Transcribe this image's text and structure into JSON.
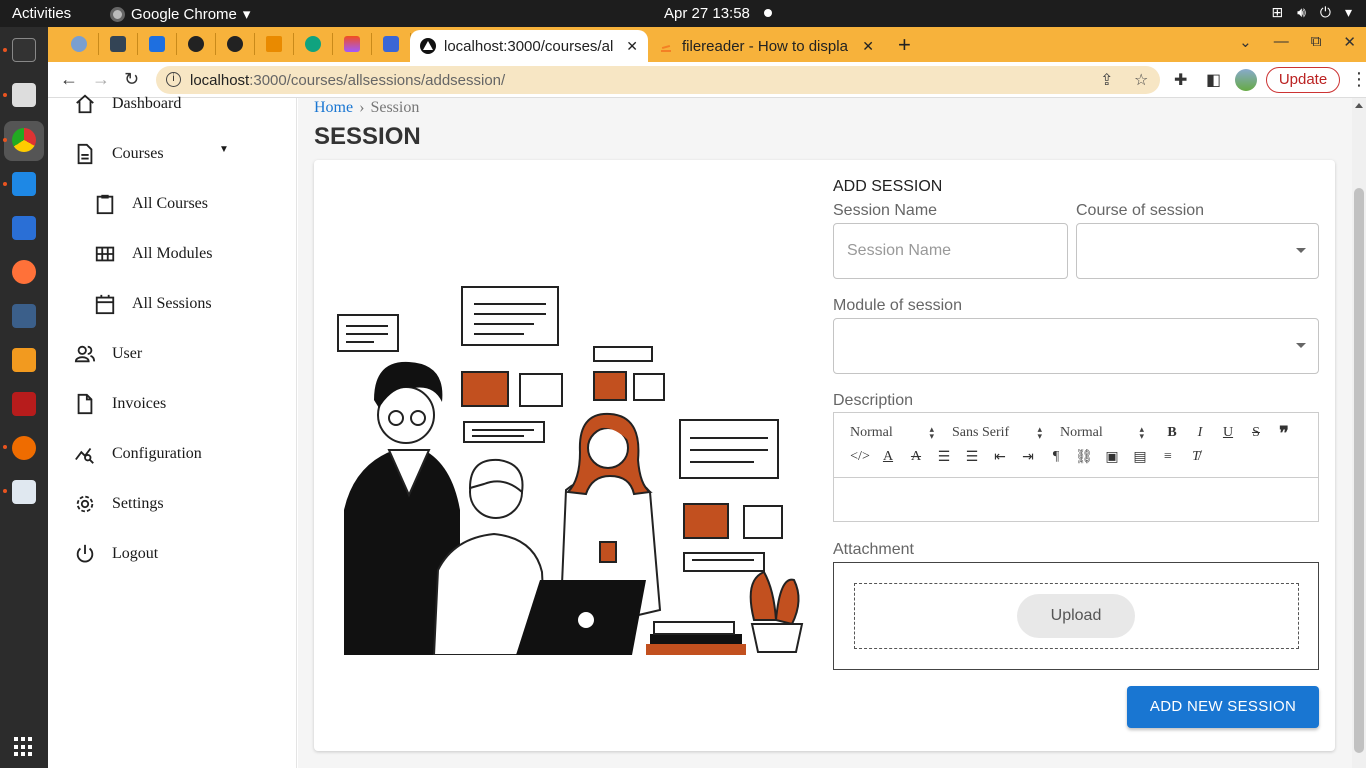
{
  "os": {
    "activities": "Activities",
    "app_name": "Google Chrome",
    "clock": "Apr 27  13:58"
  },
  "browser": {
    "tabs": [
      {
        "title": "localhost:3000/courses/al",
        "active": true
      },
      {
        "title": "filereader - How to displa",
        "active": false
      }
    ],
    "url_host": "localhost",
    "url_path": ":3000/courses/allsessions/addsession/",
    "update_label": "Update"
  },
  "sidebar": {
    "items": [
      {
        "label": "Dashboard",
        "icon": "home-icon"
      },
      {
        "label": "Courses",
        "icon": "document-icon"
      },
      {
        "label": "All Courses",
        "icon": "clipboard-icon"
      },
      {
        "label": "All Modules",
        "icon": "grid-icon"
      },
      {
        "label": "All Sessions",
        "icon": "calendar-icon"
      },
      {
        "label": "User",
        "icon": "people-icon"
      },
      {
        "label": "Invoices",
        "icon": "file-icon"
      },
      {
        "label": "Configuration",
        "icon": "analytics-icon"
      },
      {
        "label": "Settings",
        "icon": "gear-icon"
      },
      {
        "label": "Logout",
        "icon": "power-icon"
      }
    ]
  },
  "breadcrumb": {
    "home": "Home",
    "separator": "›",
    "current": "Session"
  },
  "page_title": "SESSION",
  "form": {
    "title": "ADD SESSION",
    "session_name_label": "Session Name",
    "session_name_placeholder": "Session Name",
    "course_label": "Course of session",
    "module_label": "Module of session",
    "description_label": "Description",
    "editor": {
      "heading_select": "Normal",
      "font_select": "Sans Serif",
      "size_select": "Normal"
    },
    "attachment_label": "Attachment",
    "upload_label": "Upload",
    "submit_label": "ADD NEW SESSION"
  },
  "colors": {
    "primary": "#1976d2",
    "chrome_tab_bar": "#f7b23b",
    "illustration_accent": "#c2501f"
  }
}
